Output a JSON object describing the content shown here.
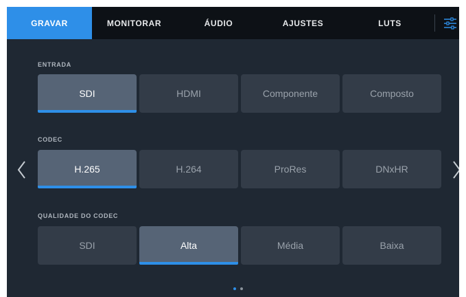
{
  "colors": {
    "accent": "#2e8fe8",
    "nav_background": "#0d1116",
    "panel_background": "#1f2833",
    "button": "#333c48",
    "button_selected": "#566476"
  },
  "nav": {
    "tabs": [
      {
        "label": "GRAVAR",
        "active": true
      },
      {
        "label": "MONITORAR",
        "active": false
      },
      {
        "label": "ÁUDIO",
        "active": false
      },
      {
        "label": "AJUSTES",
        "active": false
      },
      {
        "label": "LUTS",
        "active": false
      }
    ],
    "settings_icon": "sliders-icon"
  },
  "sections": [
    {
      "label": "ENTRADA",
      "options": [
        "SDI",
        "HDMI",
        "Componente",
        "Composto"
      ],
      "selected": "SDI"
    },
    {
      "label": "CODEC",
      "options": [
        "H.265",
        "H.264",
        "ProRes",
        "DNxHR"
      ],
      "selected": "H.265"
    },
    {
      "label": "QUALIDADE DO CODEC",
      "options": [
        "SDI",
        "Alta",
        "Média",
        "Baixa"
      ],
      "selected": "Alta"
    }
  ],
  "navigation": {
    "prev_icon": "chevron-left-icon",
    "next_icon": "chevron-right-icon"
  },
  "pagination": {
    "total_pages": 2,
    "current_page": 1
  }
}
